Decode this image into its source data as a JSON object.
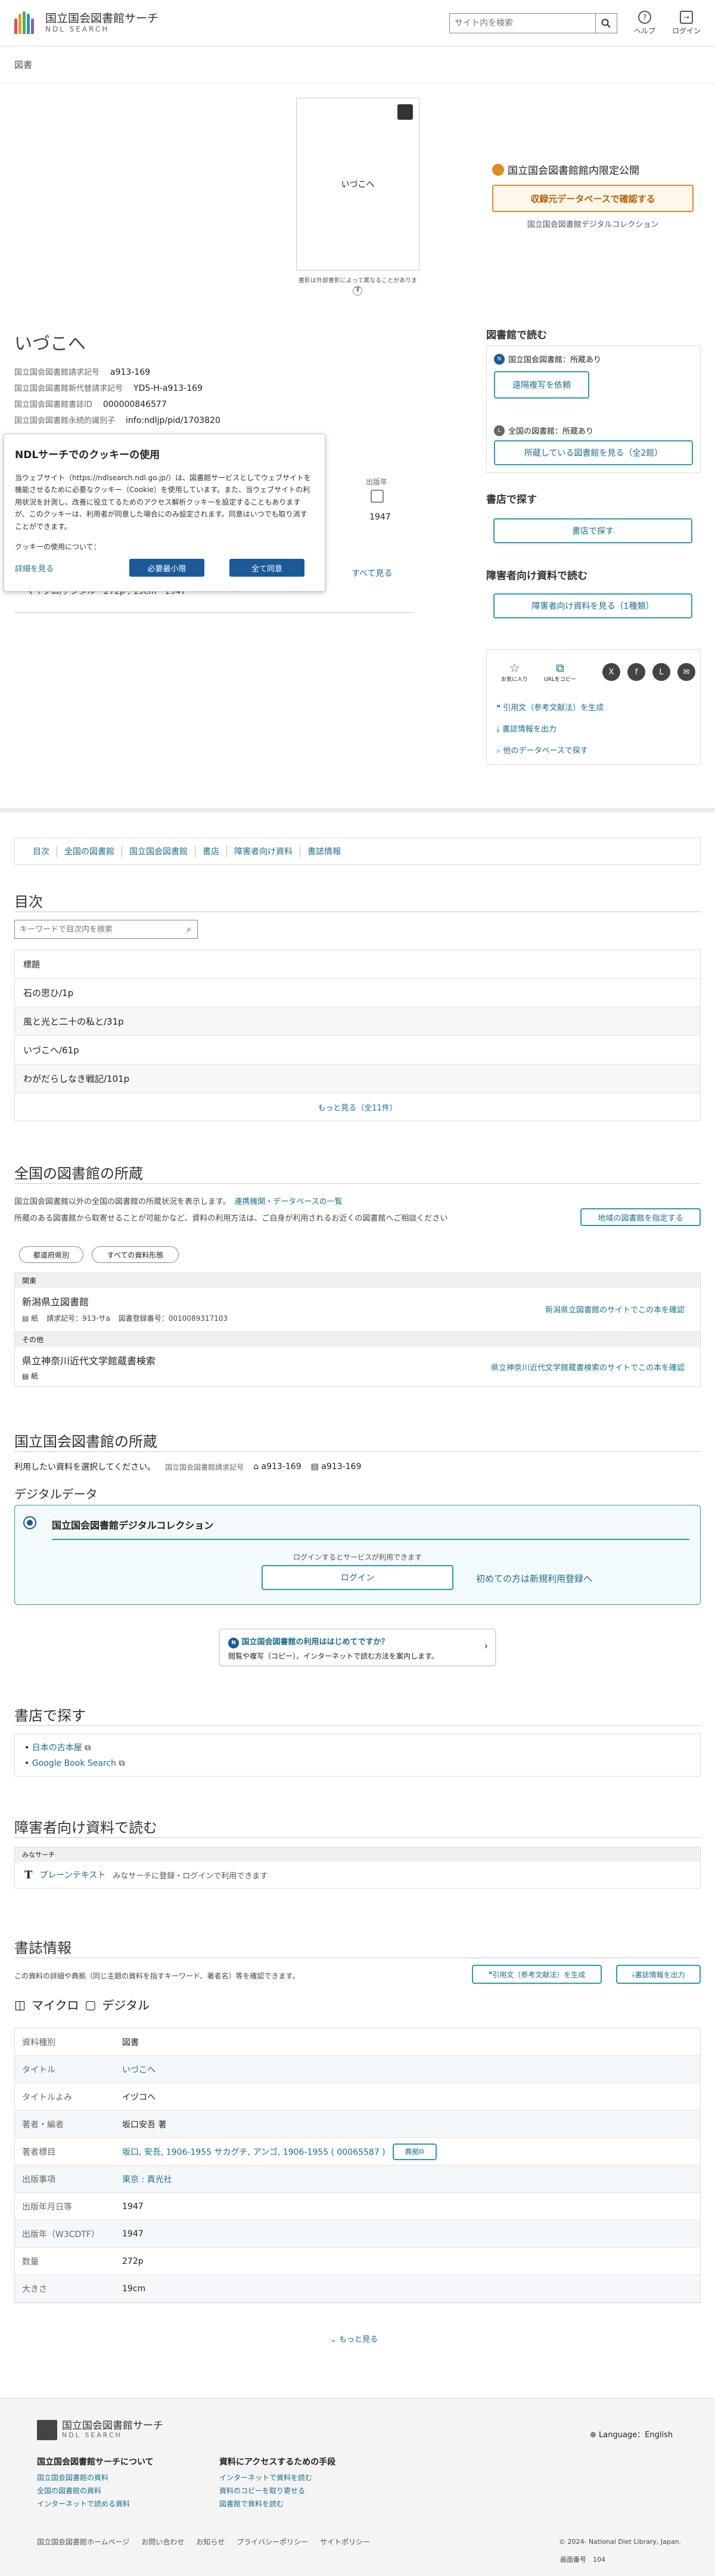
{
  "header": {
    "logo_jp": "国立国会図書館サーチ",
    "logo_en": "NDL SEARCH",
    "search_placeholder": "サイト内を検索",
    "help": "ヘルプ",
    "login": "ログイン"
  },
  "breadcrumb": "図書",
  "thumbnail": {
    "title": "いづこへ",
    "note": "書影は外部書影によって異なることがあります",
    "info": "i"
  },
  "access": {
    "label": "国立国会図書館館内限定公開",
    "confirm_button": "収録元データベースで確認する",
    "source": "国立国会図書館デジタルコレクション"
  },
  "item": {
    "title": "いづこへ",
    "fields": [
      {
        "k": "国立国会図書館請求記号",
        "v": "a913-169"
      },
      {
        "k": "国立国会図書館新代替請求記号",
        "v": "YD5-H-a913-169"
      },
      {
        "k": "国立国会図書館書誌ID",
        "v": "000000846577"
      },
      {
        "k": "国立国会図書館永続的識別子",
        "v": "info:ndljp/pid/1703820"
      }
    ],
    "year_label": "出版年",
    "year": "1947",
    "see_all": "すべて見る",
    "row_text": "マイクロ/デジタル",
    "row_pages": "272p ; 19cm",
    "row_no": "1947"
  },
  "cookie": {
    "title": "NDLサーチでのクッキーの使用",
    "body": "当ウェブサイト（https://ndlsearch.ndl.go.jp/）は、図書館サービスとしてウェブサイトを機能させるために必要なクッキー（Cookie）を使用しています。また、当ウェブサイトの利用状況を計測し、改善に役立てるためのアクセス解析クッキーを設定することもありますが、このクッキーは、利用者が同意した場合にのみ設定されます。同意はいつでも取り消すことができます。",
    "question": "クッキーの使用について：",
    "detail": "詳細を見る",
    "necessary": "必要最小限",
    "all": "全て同意"
  },
  "sidebar": {
    "read_title": "図書館で読む",
    "ndl_holding": "国立国会図書館：所蔵あり",
    "copy_button": "遠隔複写を依頼",
    "all_holding": "全国の図書館：所蔵あり",
    "view_libs": "所蔵している図書館を見る（全2館）",
    "shop_title": "書店で探す",
    "shop_button": "書店で探す",
    "disab_title": "障害者向け資料で読む",
    "disab_button": "障害者向け資料を見る（1種類）",
    "fav": "お気に入り",
    "url": "URLをコピー",
    "cite": "引用文（参考文献法）を生成",
    "export": "書誌情報を出力",
    "other_db": "他のデータベースで探す"
  },
  "tabs": [
    "目次",
    "全国の図書館",
    "国立国会図書館",
    "書店",
    "障害者向け資料",
    "書誌情報"
  ],
  "toc": {
    "title": "目次",
    "placeholder": "キーワードで目次内を検索",
    "header": "標題",
    "items": [
      "石の思ひ/1p",
      "風と光と二十の私と/31p",
      "いづこへ/61p",
      "わがだらしなき戦記/101p"
    ],
    "more": "もっと見る（全11件）"
  },
  "libs": {
    "title": "全国の図書館の所蔵",
    "desc": "国立国会図書館以外の全国の図書館の所蔵状況を表示します。",
    "link": "連携機関・データベースの一覧",
    "desc2": "所蔵のある図書館から取寄せることが可能かなど、資料の利用方法は、ご自身が利用されるお近くの図書館へご相談ください",
    "region_btn": "地域の図書館を指定する",
    "filter1": "都道府県別",
    "filter2": "すべての資料形態",
    "group1": "関東",
    "lib1": "新潟県立図書館",
    "lib1_type": "紙",
    "lib1_call": "請求記号：913-サa",
    "lib1_id": "図書登録番号：0010089317103",
    "lib1_link": "新潟県立図書館のサイトでこの本を確認",
    "group2": "その他",
    "lib2": "県立神奈川近代文学館蔵書検索",
    "lib2_type": "紙",
    "lib2_link": "県立神奈川近代文学館蔵書検索のサイトでこの本を確認"
  },
  "ndl": {
    "title": "国立国会図書館の所蔵",
    "desc": "利用したい資料を選択してください。",
    "call_label": "国立国会図書館請求記号",
    "call1": "a913-169",
    "call2": "a913-169",
    "digital_title": "デジタルデータ",
    "dc": "国立国会図書館デジタルコレクション",
    "login_note": "ログインするとサービスが利用できます",
    "login": "ログイン",
    "register": "初めての方は新規利用登録へ",
    "first_title": "国立国会図書館の利用ははじめてですか？",
    "first_desc": "閲覧や複写（コピー）、インターネットで読む方法を案内します。"
  },
  "shop": {
    "title": "書店で探す",
    "items": [
      "日本の古本屋",
      "Google Book Search"
    ]
  },
  "disab": {
    "title": "障害者向け資料で読む",
    "group": "みなサーチ",
    "type": "プレーンテキスト",
    "note": "みなサーチに登録・ログインで利用できます"
  },
  "bib": {
    "title": "書誌情報",
    "desc": "この資料の詳細や典拠（同じ主題の資料を指すキーワード、著者名）等を確認できます。",
    "cite": "引用文（参考文献法）を生成",
    "export": "書誌情報を出力",
    "format": "マイクロ",
    "format2": "デジタル",
    "rows": [
      {
        "k": "資料種別",
        "v": "図書"
      },
      {
        "k": "タイトル",
        "v": "いづこへ"
      },
      {
        "k": "タイトルよみ",
        "v": "イヅコヘ"
      },
      {
        "k": "著者・編者",
        "v": "坂口安吾 著"
      },
      {
        "k": "著者標目",
        "v": "坂口, 安吾, 1906-1955 サカグチ, アンゴ, 1906-1955 ( 00065587 )"
      },
      {
        "k": "出版事項",
        "v": "東京 : 真光社"
      },
      {
        "k": "出版年月日等",
        "v": "1947"
      },
      {
        "k": "出版年（W3CDTF）",
        "v": "1947"
      },
      {
        "k": "数量",
        "v": "272p"
      },
      {
        "k": "大きさ",
        "v": "19cm"
      }
    ],
    "authority": "典拠",
    "more": "もっと見る"
  },
  "footer": {
    "logo_jp": "国立国会図書館サーチ",
    "logo_en": "NDL SEARCH",
    "lang": "Language：English",
    "col1_title": "国立国会図書館サーチについて",
    "col1": [
      "国立国会図書館の資料",
      "全国の図書館の資料",
      "インターネットで読める資料"
    ],
    "col2_title": "資料にアクセスするための手段",
    "col2": [
      "インターネットで資料を読む",
      "資料のコピーを取り寄せる",
      "図書館で資料を読む"
    ],
    "links": [
      "国立国会図書館ホームページ",
      "お問い合わせ",
      "お知らせ",
      "プライバシーポリシー",
      "サイトポリシー"
    ],
    "copy": "© 2024- National Diet Library, Japan.",
    "screen_label": "画面番号",
    "screen_no": "104"
  }
}
